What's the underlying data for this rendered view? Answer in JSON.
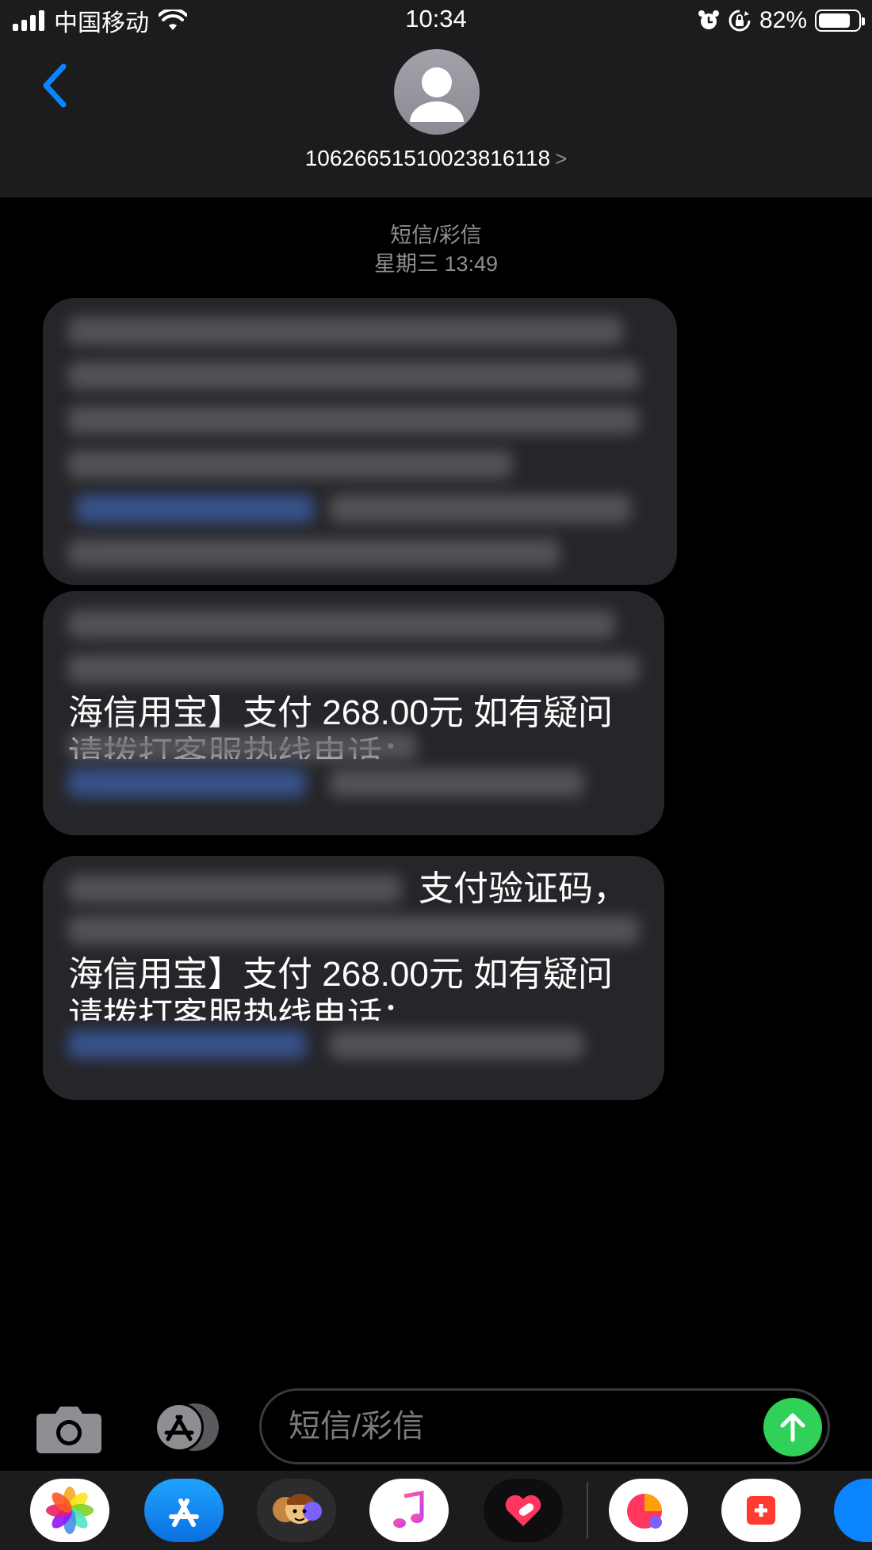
{
  "status_bar": {
    "carrier": "中国移动",
    "time": "10:34",
    "battery_percent": "82%",
    "battery_level": 0.82,
    "signal_bars": 4,
    "icons": [
      "signal-icon",
      "wifi-icon",
      "alarm-icon",
      "rotation-lock-icon",
      "battery-icon"
    ]
  },
  "header": {
    "back_icon": "chevron-left-icon",
    "contact_number": "10626651510023816118",
    "contact_chevron": ">",
    "avatar_icon": "person-silhouette-icon"
  },
  "thread": {
    "service_label": "短信/彩信",
    "timestamp": "星期三 13:49",
    "messages": [
      {
        "visible_lines": []
      },
      {
        "visible_lines": [
          "海信用宝】支付 268.00元 如有疑问",
          "请拨打客服热线电话："
        ]
      },
      {
        "visible_lines": [
          "支付验证码，",
          "海信用宝】支付 268.00元 如有疑问",
          "请拨打客服热线电话："
        ]
      }
    ]
  },
  "composer": {
    "camera_icon": "camera-icon",
    "apps_icon": "app-store-icon",
    "placeholder": "短信/彩信",
    "send_icon": "arrow-up-icon"
  },
  "app_drawer": {
    "apps": [
      "photos-icon",
      "app-store-icon",
      "memoji-icon",
      "music-icon",
      "health-icon",
      "app-icon",
      "app-icon",
      "app-icon"
    ]
  },
  "colors": {
    "accent_blue": "#0a84ff",
    "send_green": "#30d158",
    "bubble_gray": "#26262a",
    "header_bg": "#1c1c1e"
  }
}
